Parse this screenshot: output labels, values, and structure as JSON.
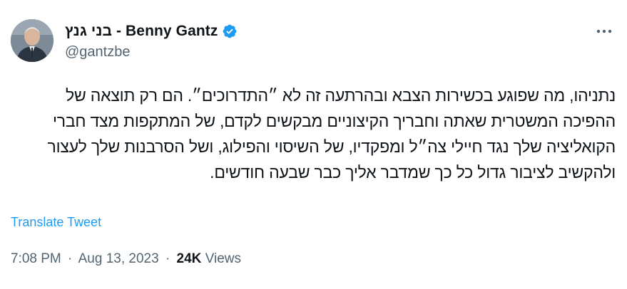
{
  "author": {
    "name": "בני גנץ - Benny Gantz",
    "handle": "@gantzbe",
    "verified": true,
    "avatar_icon": "profile-photo"
  },
  "menu": {
    "icon": "more-dots-icon"
  },
  "tweet": {
    "text": "נתניהו, מה שפוגע בכשירות הצבא ובהרתעה זה לא ״התדרוכים״. הם רק תוצאה של ההפיכה המשטרית שאתה וחבריך הקיצוניים מבקשים לקדם, של המתקפות מצד חברי הקואליציה שלך נגד חיילי צה״ל ומפקדיו, של השיסוי והפילוג, ושל הסרבנות שלך לעצור ולהקשיב לציבור גדול כל כך שמדבר אליך כבר שבעה חודשים.",
    "translate_label": "Translate Tweet"
  },
  "meta": {
    "time": "7:08 PM",
    "separator": "·",
    "date": "Aug 13, 2023",
    "views_count": "24K",
    "views_label": "Views"
  },
  "colors": {
    "accent": "#1d9bf0",
    "text": "#0f1419",
    "secondary": "#536471"
  }
}
